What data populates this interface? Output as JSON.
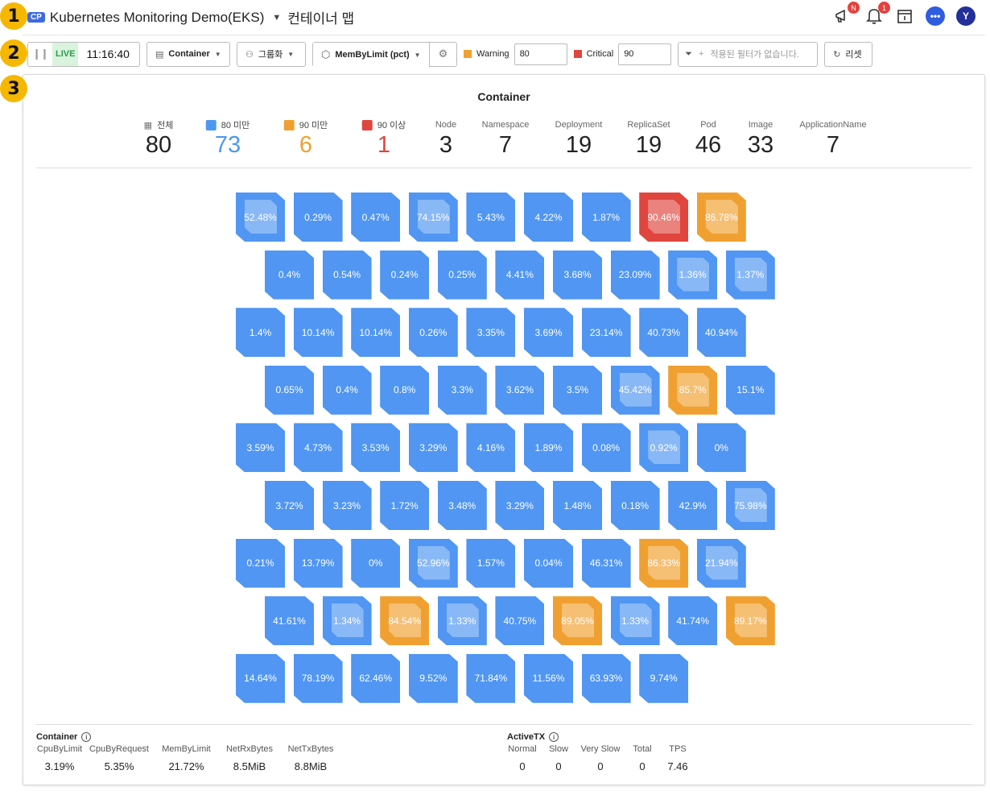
{
  "markers": [
    "1",
    "2",
    "3"
  ],
  "header": {
    "chip": "CP",
    "project": "Kubernetes Monitoring Demo(EKS)",
    "page_title": "컨테이너 맵",
    "notice_badge": "N",
    "alert_badge": "1",
    "avatar": "Y",
    "chat_glyph": "•••"
  },
  "toolbar": {
    "live_label": "LIVE",
    "time": "11:16:40",
    "view_label": "Container",
    "group_label": "그룹화",
    "metric_label": "MemByLimit (pct)",
    "warning_label": "Warning",
    "warning_value": "80",
    "critical_label": "Critical",
    "critical_value": "90",
    "filter_placeholder": "적용된 필터가 없습니다.",
    "reset_label": "리셋"
  },
  "panel": {
    "title": "Container",
    "stats": [
      {
        "label": "전체",
        "value": "80",
        "color": "#222222",
        "legend": "grid"
      },
      {
        "label": "80 미만",
        "value": "73",
        "color": "#4e97f2",
        "legend": "#4e97f2"
      },
      {
        "label": "90 미만",
        "value": "6",
        "color": "#f0a030",
        "legend": "#f0a030"
      },
      {
        "label": "90 이상",
        "value": "1",
        "color": "#e0453e",
        "legend": "#e0453e"
      },
      {
        "label": "Node",
        "value": "3",
        "color": "#222222"
      },
      {
        "label": "Namespace",
        "value": "7",
        "color": "#222222"
      },
      {
        "label": "Deployment",
        "value": "19",
        "color": "#222222"
      },
      {
        "label": "ReplicaSet",
        "value": "19",
        "color": "#222222"
      },
      {
        "label": "Pod",
        "value": "46",
        "color": "#222222"
      },
      {
        "label": "Image",
        "value": "33",
        "color": "#222222"
      },
      {
        "label": "ApplicationName",
        "value": "7",
        "color": "#222222"
      }
    ]
  },
  "colors": {
    "normal": "#5096f2",
    "warning": "#f0a030",
    "critical": "#e0453e"
  },
  "tiles": [
    [
      {
        "v": "52.48%",
        "s": "n",
        "i": "box"
      },
      {
        "v": "0.29%",
        "s": "n"
      },
      {
        "v": "0.47%",
        "s": "n"
      },
      {
        "v": "74.15%",
        "s": "n",
        "i": "box"
      },
      {
        "v": "5.43%",
        "s": "n"
      },
      {
        "v": "4.22%",
        "s": "n"
      },
      {
        "v": "1.87%",
        "s": "n"
      },
      {
        "v": "90.46%",
        "s": "c",
        "i": "java"
      },
      {
        "v": "86.78%",
        "s": "w",
        "i": "java"
      }
    ],
    [
      {
        "v": "0.4%",
        "s": "n"
      },
      {
        "v": "0.54%",
        "s": "n"
      },
      {
        "v": "0.24%",
        "s": "n"
      },
      {
        "v": "0.25%",
        "s": "n"
      },
      {
        "v": "4.41%",
        "s": "n"
      },
      {
        "v": "3.68%",
        "s": "n"
      },
      {
        "v": "23.09%",
        "s": "n"
      },
      {
        "v": "1.36%",
        "s": "n",
        "i": "stack"
      },
      {
        "v": "1.37%",
        "s": "n",
        "i": "stack"
      }
    ],
    [
      {
        "v": "1.4%",
        "s": "n"
      },
      {
        "v": "10.14%",
        "s": "n"
      },
      {
        "v": "10.14%",
        "s": "n"
      },
      {
        "v": "0.26%",
        "s": "n"
      },
      {
        "v": "3.35%",
        "s": "n"
      },
      {
        "v": "3.69%",
        "s": "n"
      },
      {
        "v": "23.14%",
        "s": "n"
      },
      {
        "v": "40.73%",
        "s": "n"
      },
      {
        "v": "40.94%",
        "s": "n"
      }
    ],
    [
      {
        "v": "0.65%",
        "s": "n"
      },
      {
        "v": "0.4%",
        "s": "n"
      },
      {
        "v": "0.8%",
        "s": "n"
      },
      {
        "v": "3.3%",
        "s": "n"
      },
      {
        "v": "3.62%",
        "s": "n"
      },
      {
        "v": "3.5%",
        "s": "n"
      },
      {
        "v": "45.42%",
        "s": "n",
        "i": "box"
      },
      {
        "v": "85.7%",
        "s": "w",
        "i": "java"
      },
      {
        "v": "15.1%",
        "s": "n"
      }
    ],
    [
      {
        "v": "3.59%",
        "s": "n"
      },
      {
        "v": "4.73%",
        "s": "n"
      },
      {
        "v": "3.53%",
        "s": "n"
      },
      {
        "v": "3.29%",
        "s": "n"
      },
      {
        "v": "4.16%",
        "s": "n"
      },
      {
        "v": "1.89%",
        "s": "n"
      },
      {
        "v": "0.08%",
        "s": "n"
      },
      {
        "v": "0.92%",
        "s": "n",
        "i": "stack"
      },
      {
        "v": "0%",
        "s": "n"
      }
    ],
    [
      {
        "v": "3.72%",
        "s": "n"
      },
      {
        "v": "3.23%",
        "s": "n"
      },
      {
        "v": "1.72%",
        "s": "n"
      },
      {
        "v": "3.48%",
        "s": "n"
      },
      {
        "v": "3.29%",
        "s": "n"
      },
      {
        "v": "1.48%",
        "s": "n"
      },
      {
        "v": "0.18%",
        "s": "n"
      },
      {
        "v": "42.9%",
        "s": "n"
      },
      {
        "v": "75.98%",
        "s": "n",
        "i": "box"
      }
    ],
    [
      {
        "v": "0.21%",
        "s": "n"
      },
      {
        "v": "13.79%",
        "s": "n"
      },
      {
        "v": "0%",
        "s": "n"
      },
      {
        "v": "52.96%",
        "s": "n",
        "i": "box"
      },
      {
        "v": "1.57%",
        "s": "n"
      },
      {
        "v": "0.04%",
        "s": "n"
      },
      {
        "v": "46.31%",
        "s": "n"
      },
      {
        "v": "86.33%",
        "s": "w",
        "i": "java"
      },
      {
        "v": "21.94%",
        "s": "n",
        "i": "box"
      }
    ],
    [
      {
        "v": "41.61%",
        "s": "n"
      },
      {
        "v": "1.34%",
        "s": "n",
        "i": "stack"
      },
      {
        "v": "84.54%",
        "s": "w",
        "i": "java"
      },
      {
        "v": "1.33%",
        "s": "n",
        "i": "stack"
      },
      {
        "v": "40.75%",
        "s": "n"
      },
      {
        "v": "89.05%",
        "s": "w",
        "i": "java"
      },
      {
        "v": "1.33%",
        "s": "n",
        "i": "stack"
      },
      {
        "v": "41.74%",
        "s": "n"
      },
      {
        "v": "89.17%",
        "s": "w",
        "i": "java"
      }
    ],
    [
      {
        "v": "14.64%",
        "s": "n"
      },
      {
        "v": "78.19%",
        "s": "n"
      },
      {
        "v": "62.46%",
        "s": "n"
      },
      {
        "v": "9.52%",
        "s": "n"
      },
      {
        "v": "71.84%",
        "s": "n"
      },
      {
        "v": "11.56%",
        "s": "n"
      },
      {
        "v": "63.93%",
        "s": "n"
      },
      {
        "v": "9.74%",
        "s": "n"
      }
    ]
  ],
  "footer": {
    "container": {
      "title": "Container",
      "cols": [
        {
          "k": "CpuByLimit",
          "v": "3.19%"
        },
        {
          "k": "CpuByRequest",
          "v": "5.35%"
        },
        {
          "k": "MemByLimit",
          "v": "21.72%"
        },
        {
          "k": "NetRxBytes",
          "v": "8.5MiB"
        },
        {
          "k": "NetTxBytes",
          "v": "8.8MiB"
        }
      ]
    },
    "activetx": {
      "title": "ActiveTX",
      "cols": [
        {
          "k": "Normal",
          "v": "0"
        },
        {
          "k": "Slow",
          "v": "0"
        },
        {
          "k": "Very Slow",
          "v": "0"
        },
        {
          "k": "Total",
          "v": "0"
        },
        {
          "k": "TPS",
          "v": "7.46"
        }
      ]
    }
  }
}
